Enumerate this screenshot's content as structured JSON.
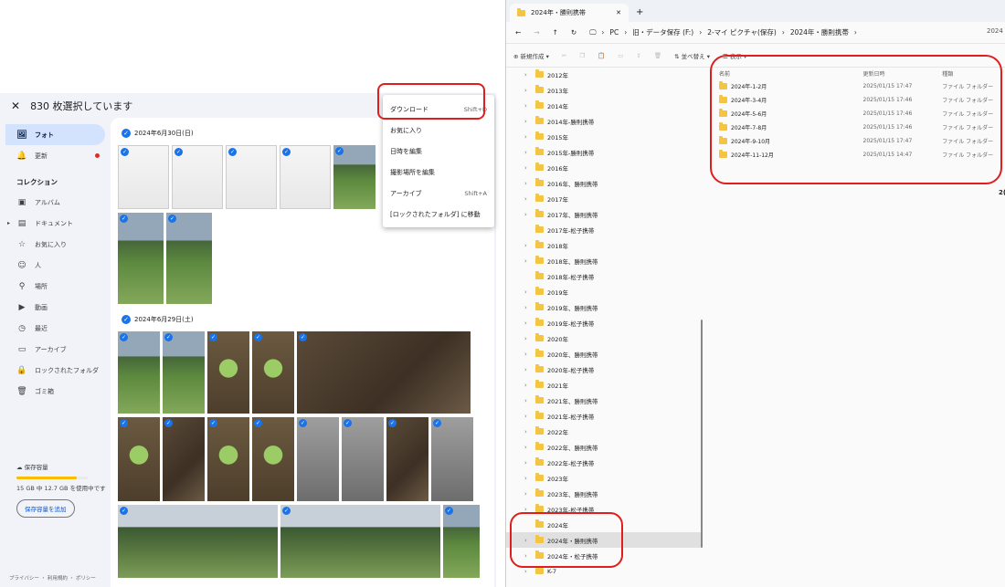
{
  "photos": {
    "selection_text": "830 枚選択しています",
    "nav": [
      {
        "label": "フォト",
        "icon": "photo-icon",
        "selected": true
      },
      {
        "label": "更新",
        "icon": "bell-icon",
        "dot": true
      }
    ],
    "collection_header": "コレクション",
    "collections": [
      {
        "label": "アルバム",
        "icon": "album-icon"
      },
      {
        "label": "ドキュメント",
        "icon": "document-icon",
        "expand": true
      },
      {
        "label": "お気に入り",
        "icon": "star-icon"
      },
      {
        "label": "人",
        "icon": "face-icon"
      },
      {
        "label": "場所",
        "icon": "place-icon"
      },
      {
        "label": "動画",
        "icon": "play-icon"
      },
      {
        "label": "最近",
        "icon": "clock-icon"
      },
      {
        "label": "アーカイブ",
        "icon": "archive-icon"
      },
      {
        "label": "ロックされたフォルダ",
        "icon": "lock-icon"
      },
      {
        "label": "ゴミ箱",
        "icon": "trash-icon"
      }
    ],
    "storage_label": "保存容量",
    "storage_text": "15 GB 中 12.7 GB を使用中です",
    "storage_fraction": 0.847,
    "storage_button": "保存容量を追加",
    "footer": "プライバシー ・ 利用規約 ・ ポリシー",
    "date1": "2024年6月30日(日)",
    "date2": "2024年6月29日(土)",
    "menu": [
      {
        "label": "ダウンロード",
        "shortcut": "Shift+D"
      },
      {
        "label": "お気に入り",
        "shortcut": ""
      },
      {
        "label": "日時を編集",
        "shortcut": ""
      },
      {
        "label": "撮影場所を編集",
        "shortcut": ""
      },
      {
        "label": "アーカイブ",
        "shortcut": "Shift+A"
      },
      {
        "label": "[ロックされたフォルダ] に移動",
        "shortcut": ""
      }
    ]
  },
  "explorer": {
    "tab_title": "2024年・勝則携帯",
    "breadcrumbs": [
      "PC",
      "旧・データ保存 (F:)",
      "2-マイ ピクチャ(保存)",
      "2024年・勝則携帯"
    ],
    "address_cut": "2024",
    "commands": {
      "new": "新規作成",
      "sort": "並べ替え",
      "view": "表示",
      "more": "···"
    },
    "tree": [
      {
        "label": "2012年",
        "arrow": true
      },
      {
        "label": "2013年",
        "arrow": true
      },
      {
        "label": "2014年",
        "arrow": true
      },
      {
        "label": "2014年-勝則携帯",
        "arrow": true
      },
      {
        "label": "2015年",
        "arrow": true
      },
      {
        "label": "2015年-勝則携帯",
        "arrow": true
      },
      {
        "label": "2016年",
        "arrow": true
      },
      {
        "label": "2016年、勝則携帯",
        "arrow": true
      },
      {
        "label": "2017年",
        "arrow": true
      },
      {
        "label": "2017年、勝則携帯",
        "arrow": true
      },
      {
        "label": "2017年-松子携帯",
        "arrow": false
      },
      {
        "label": "2018年",
        "arrow": true
      },
      {
        "label": "2018年、勝則携帯",
        "arrow": true
      },
      {
        "label": "2018年-松子携帯",
        "arrow": false
      },
      {
        "label": "2019年",
        "arrow": true
      },
      {
        "label": "2019年、勝則携帯",
        "arrow": true
      },
      {
        "label": "2019年-松子携帯",
        "arrow": true
      },
      {
        "label": "2020年",
        "arrow": true
      },
      {
        "label": "2020年、勝則携帯",
        "arrow": true
      },
      {
        "label": "2020年-松子携帯",
        "arrow": true
      },
      {
        "label": "2021年",
        "arrow": true
      },
      {
        "label": "2021年、勝則携帯",
        "arrow": true
      },
      {
        "label": "2021年-松子携帯",
        "arrow": true
      },
      {
        "label": "2022年",
        "arrow": true
      },
      {
        "label": "2022年、勝則携帯",
        "arrow": true
      },
      {
        "label": "2022年-松子携帯",
        "arrow": true
      },
      {
        "label": "2023年",
        "arrow": true
      },
      {
        "label": "2023年、勝則携帯",
        "arrow": true
      },
      {
        "label": "2023年-松子携帯",
        "arrow": true
      },
      {
        "label": "2024年",
        "arrow": false
      },
      {
        "label": "2024年・勝則携帯",
        "arrow": true,
        "selected": true
      },
      {
        "label": "2024年・松子携帯",
        "arrow": true
      },
      {
        "label": "K-7",
        "arrow": true
      }
    ],
    "columns": {
      "name": "名前",
      "date": "更新日時",
      "type": "種類"
    },
    "files": [
      {
        "name": "2024年-1-2月",
        "date": "2025/01/15 17:47",
        "type": "ファイル フォルダー"
      },
      {
        "name": "2024年-3-4月",
        "date": "2025/01/15 17:46",
        "type": "ファイル フォルダー"
      },
      {
        "name": "2024年-5-6月",
        "date": "2025/01/15 17:46",
        "type": "ファイル フォルダー"
      },
      {
        "name": "2024年-7-8月",
        "date": "2025/01/15 17:46",
        "type": "ファイル フォルダー"
      },
      {
        "name": "2024年-9-10月",
        "date": "2025/01/15 17:47",
        "type": "ファイル フォルダー"
      },
      {
        "name": "2024年-11-12月",
        "date": "2025/01/15 14:47",
        "type": "ファイル フォルダー"
      }
    ],
    "cutoff_right": "2("
  }
}
